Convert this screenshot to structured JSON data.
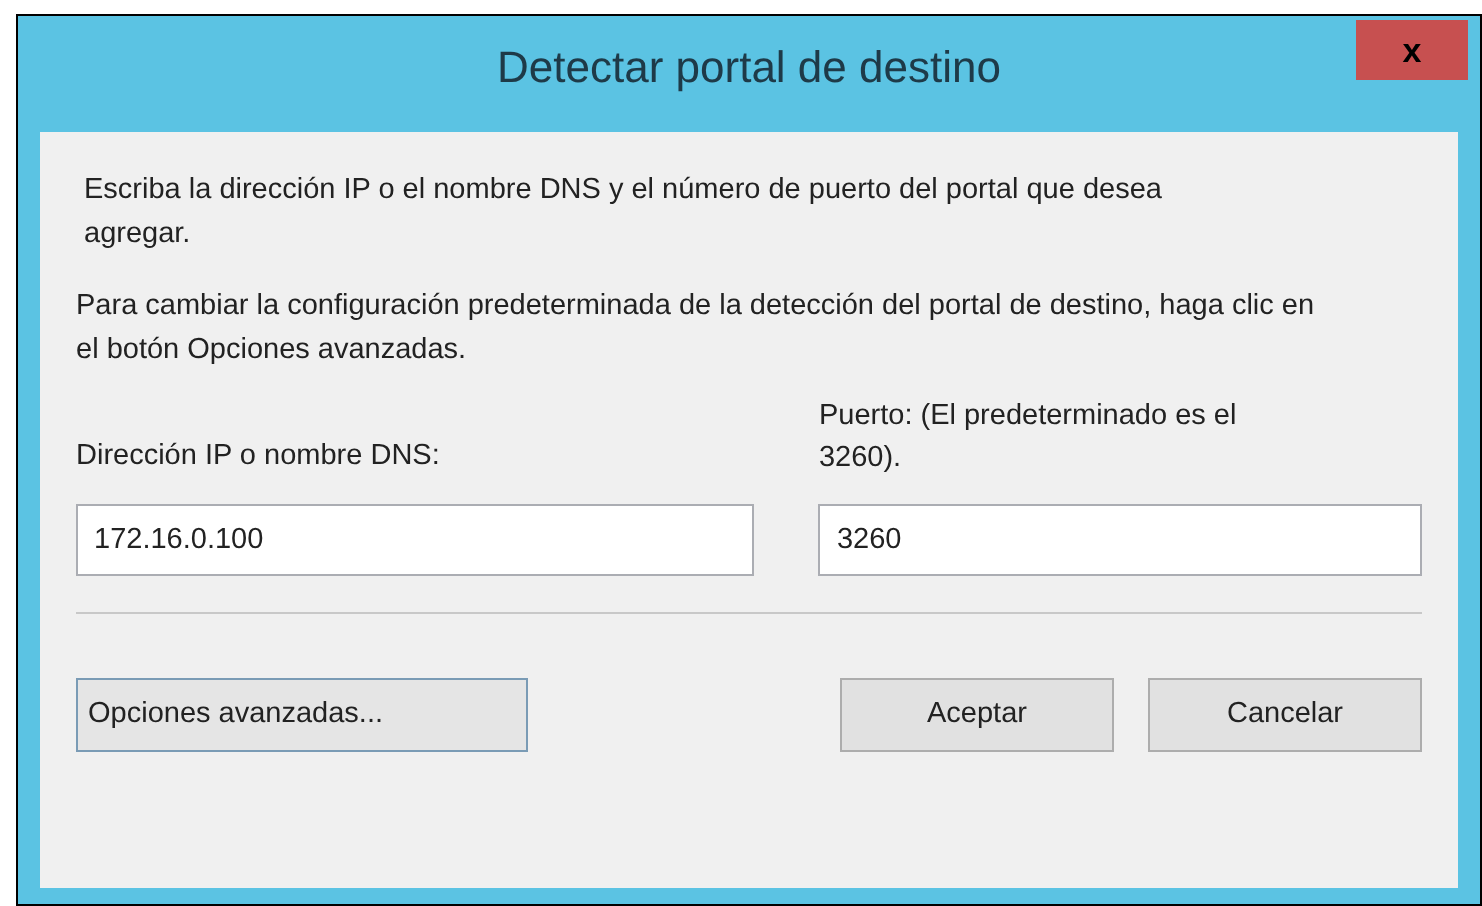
{
  "window": {
    "title": "Detectar portal de destino",
    "close": "x"
  },
  "instructions": [
    "Escriba la dirección IP o el nombre DNS y el número de puerto del portal que desea agregar.",
    "Para cambiar la configuración predeterminada de la detección del portal de destino, haga clic en el botón Opciones avanzadas."
  ],
  "fields": [
    {
      "label": "Dirección IP o nombre DNS:",
      "value": "172.16.0.100"
    },
    {
      "label": "Puerto: (El predeterminado es el 3260).",
      "value": "3260"
    }
  ],
  "buttons": [
    "Opciones avanzadas...",
    "Aceptar",
    "Cancelar"
  ]
}
